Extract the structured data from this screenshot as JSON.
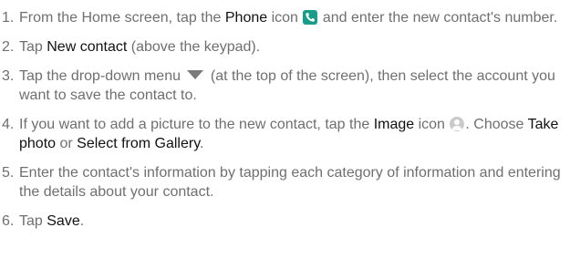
{
  "steps": [
    {
      "number": "1.",
      "a": "From the Home screen, tap the ",
      "b": "Phone",
      "c": " icon ",
      "d": " and enter the new contact's number."
    },
    {
      "number": "2.",
      "a": "Tap ",
      "b": "New contact",
      "c": " (above the keypad)."
    },
    {
      "number": "3.",
      "a": "Tap the drop-down menu ",
      "b": " (at the top of the screen), then select the account you want to save the contact to."
    },
    {
      "number": "4.",
      "a": "If you want to add a picture to the new contact, tap the ",
      "b": "Image",
      "c": " icon ",
      "d": ". Choose ",
      "e": "Take photo",
      "f": " or ",
      "g": "Select from Gallery",
      "h": "."
    },
    {
      "number": "5.",
      "a": "Enter the contact's information by tapping each category of information and entering the details about your contact."
    },
    {
      "number": "6.",
      "a": "Tap ",
      "b": "Save",
      "c": "."
    }
  ],
  "icons": {
    "phone": "phone-icon",
    "dropdown": "dropdown-arrow-icon",
    "image": "image-icon"
  },
  "colors": {
    "body_text": "#6f6f6f",
    "emphasis_text": "#111111",
    "phone_icon_bg": "#1a9c8a"
  }
}
